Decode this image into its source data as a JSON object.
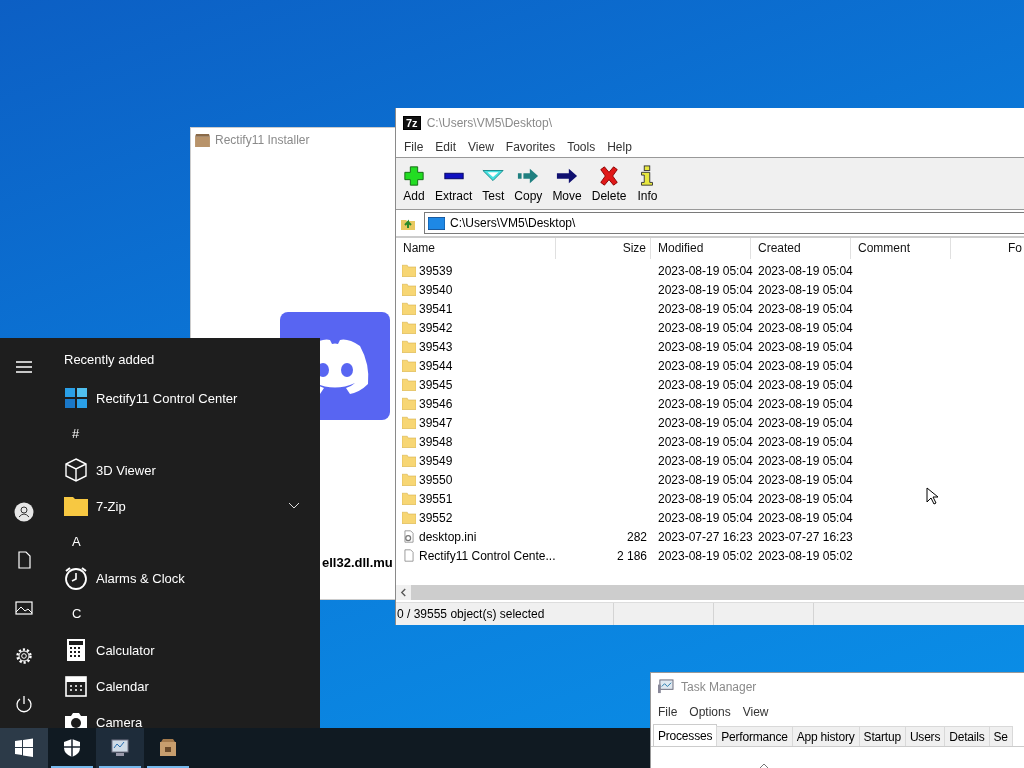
{
  "installer_window": {
    "title": "Rectify11 Installer",
    "file_label": "ell32.dll.mu"
  },
  "archive_window": {
    "logo": "7z",
    "title": "C:\\Users\\VM5\\Desktop\\",
    "menu": [
      "File",
      "Edit",
      "View",
      "Favorites",
      "Tools",
      "Help"
    ],
    "toolbar": [
      {
        "label": "Add",
        "kind": "add"
      },
      {
        "label": "Extract",
        "kind": "extract"
      },
      {
        "label": "Test",
        "kind": "test"
      },
      {
        "label": "Copy",
        "kind": "copy"
      },
      {
        "label": "Move",
        "kind": "move"
      },
      {
        "label": "Delete",
        "kind": "delete"
      },
      {
        "label": "Info",
        "kind": "info"
      }
    ],
    "path": "C:\\Users\\VM5\\Desktop\\",
    "columns": [
      "Name",
      "Size",
      "Modified",
      "Created",
      "Comment",
      "Fo"
    ],
    "rows": [
      {
        "kind": "folder",
        "name": "39539",
        "modified": "2023-08-19 05:04",
        "created": "2023-08-19 05:04"
      },
      {
        "kind": "folder",
        "name": "39540",
        "modified": "2023-08-19 05:04",
        "created": "2023-08-19 05:04"
      },
      {
        "kind": "folder",
        "name": "39541",
        "modified": "2023-08-19 05:04",
        "created": "2023-08-19 05:04"
      },
      {
        "kind": "folder",
        "name": "39542",
        "modified": "2023-08-19 05:04",
        "created": "2023-08-19 05:04"
      },
      {
        "kind": "folder",
        "name": "39543",
        "modified": "2023-08-19 05:04",
        "created": "2023-08-19 05:04"
      },
      {
        "kind": "folder",
        "name": "39544",
        "modified": "2023-08-19 05:04",
        "created": "2023-08-19 05:04"
      },
      {
        "kind": "folder",
        "name": "39545",
        "modified": "2023-08-19 05:04",
        "created": "2023-08-19 05:04"
      },
      {
        "kind": "folder",
        "name": "39546",
        "modified": "2023-08-19 05:04",
        "created": "2023-08-19 05:04"
      },
      {
        "kind": "folder",
        "name": "39547",
        "modified": "2023-08-19 05:04",
        "created": "2023-08-19 05:04"
      },
      {
        "kind": "folder",
        "name": "39548",
        "modified": "2023-08-19 05:04",
        "created": "2023-08-19 05:04"
      },
      {
        "kind": "folder",
        "name": "39549",
        "modified": "2023-08-19 05:04",
        "created": "2023-08-19 05:04"
      },
      {
        "kind": "folder",
        "name": "39550",
        "modified": "2023-08-19 05:04",
        "created": "2023-08-19 05:04"
      },
      {
        "kind": "folder",
        "name": "39551",
        "modified": "2023-08-19 05:04",
        "created": "2023-08-19 05:04"
      },
      {
        "kind": "folder",
        "name": "39552",
        "modified": "2023-08-19 05:04",
        "created": "2023-08-19 05:04"
      },
      {
        "kind": "settings_file",
        "name": "desktop.ini",
        "size": "282",
        "modified": "2023-07-27 16:23",
        "created": "2023-07-27 16:23"
      },
      {
        "kind": "file",
        "name": "Rectify11 Control Cente...",
        "size": "2 186",
        "modified": "2023-08-19 05:02",
        "created": "2023-08-19 05:02"
      }
    ],
    "status": "0 / 39555 object(s) selected"
  },
  "start_menu": {
    "items": [
      {
        "kind": "section",
        "label": "Recently added"
      },
      {
        "kind": "app",
        "label": "Rectify11 Control Center",
        "expandable": false
      },
      {
        "kind": "letter",
        "label": "#"
      },
      {
        "kind": "app",
        "label": "3D Viewer",
        "expandable": false
      },
      {
        "kind": "app",
        "label": "7-Zip",
        "expandable": true
      },
      {
        "kind": "letter",
        "label": "A"
      },
      {
        "kind": "app",
        "label": "Alarms & Clock",
        "expandable": false
      },
      {
        "kind": "letter",
        "label": "C"
      },
      {
        "kind": "app",
        "label": "Calculator",
        "expandable": false
      },
      {
        "kind": "app",
        "label": "Calendar",
        "expandable": false
      },
      {
        "kind": "app",
        "label": "Camera",
        "expandable": false
      }
    ]
  },
  "task_manager": {
    "title": "Task Manager",
    "menu": [
      "File",
      "Options",
      "View"
    ],
    "tabs": [
      {
        "label": "Processes",
        "selected": true
      },
      {
        "label": "Performance",
        "selected": false
      },
      {
        "label": "App history",
        "selected": false
      },
      {
        "label": "Startup",
        "selected": false
      },
      {
        "label": "Users",
        "selected": false
      },
      {
        "label": "Details",
        "selected": false
      },
      {
        "label": "Se",
        "selected": false
      }
    ]
  },
  "taskbar": {
    "items": [
      {
        "running": false
      },
      {
        "running": true
      },
      {
        "running": true
      },
      {
        "running": true
      }
    ]
  }
}
